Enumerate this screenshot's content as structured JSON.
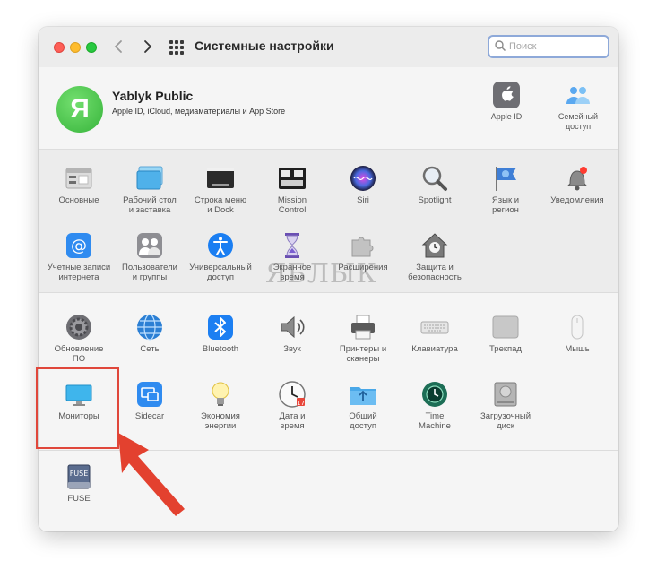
{
  "window": {
    "title": "Системные настройки",
    "search": {
      "placeholder": "Поиск",
      "value": ""
    }
  },
  "profile": {
    "avatar_letter": "Я",
    "name": "Yablyk Public",
    "subtitle": "Apple ID, iCloud, медиаматериалы и App Store",
    "apple_id_label": "Apple ID",
    "family_label_1": "Семейный",
    "family_label_2": "доступ"
  },
  "prefs": {
    "general": [
      "Основные"
    ],
    "desktop": [
      "Рабочий стол",
      "и заставка"
    ],
    "dock": [
      "Строка меню",
      "и Dock"
    ],
    "mission_control": [
      "Mission",
      "Control"
    ],
    "siri": [
      "Siri"
    ],
    "spotlight": [
      "Spotlight"
    ],
    "language": [
      "Язык и",
      "регион"
    ],
    "notifications": [
      "Уведомления"
    ],
    "internet_accounts": [
      "Учетные записи",
      "интернета"
    ],
    "users": [
      "Пользователи",
      "и группы"
    ],
    "accessibility": [
      "Универсальный",
      "доступ"
    ],
    "screen_time": [
      "Экранное",
      "время"
    ],
    "extensions": [
      "Расширения"
    ],
    "security": [
      "Защита и",
      "безопасность"
    ],
    "software_update": [
      "Обновление",
      "ПО"
    ],
    "network": [
      "Сеть"
    ],
    "bluetooth": [
      "Bluetooth"
    ],
    "sound": [
      "Звук"
    ],
    "printers": [
      "Принтеры и",
      "сканеры"
    ],
    "keyboard": [
      "Клавиатура"
    ],
    "trackpad": [
      "Трекпад"
    ],
    "mouse": [
      "Мышь"
    ],
    "displays": [
      "Мониторы"
    ],
    "sidecar": [
      "Sidecar"
    ],
    "energy": [
      "Экономия",
      "энергии"
    ],
    "date_time": [
      "Дата и",
      "время"
    ],
    "sharing": [
      "Общий",
      "доступ"
    ],
    "time_machine": [
      "Time",
      "Machine"
    ],
    "startup_disk": [
      "Загрузочный",
      "диск"
    ],
    "fuse": [
      "FUSE"
    ]
  },
  "fuse_icon_text": "FUSE",
  "watermark": "ЯБЛЫК",
  "colors": {
    "highlight": "#e0473b",
    "avatar": "#3fbf3f",
    "accent": "#2f7de1"
  }
}
